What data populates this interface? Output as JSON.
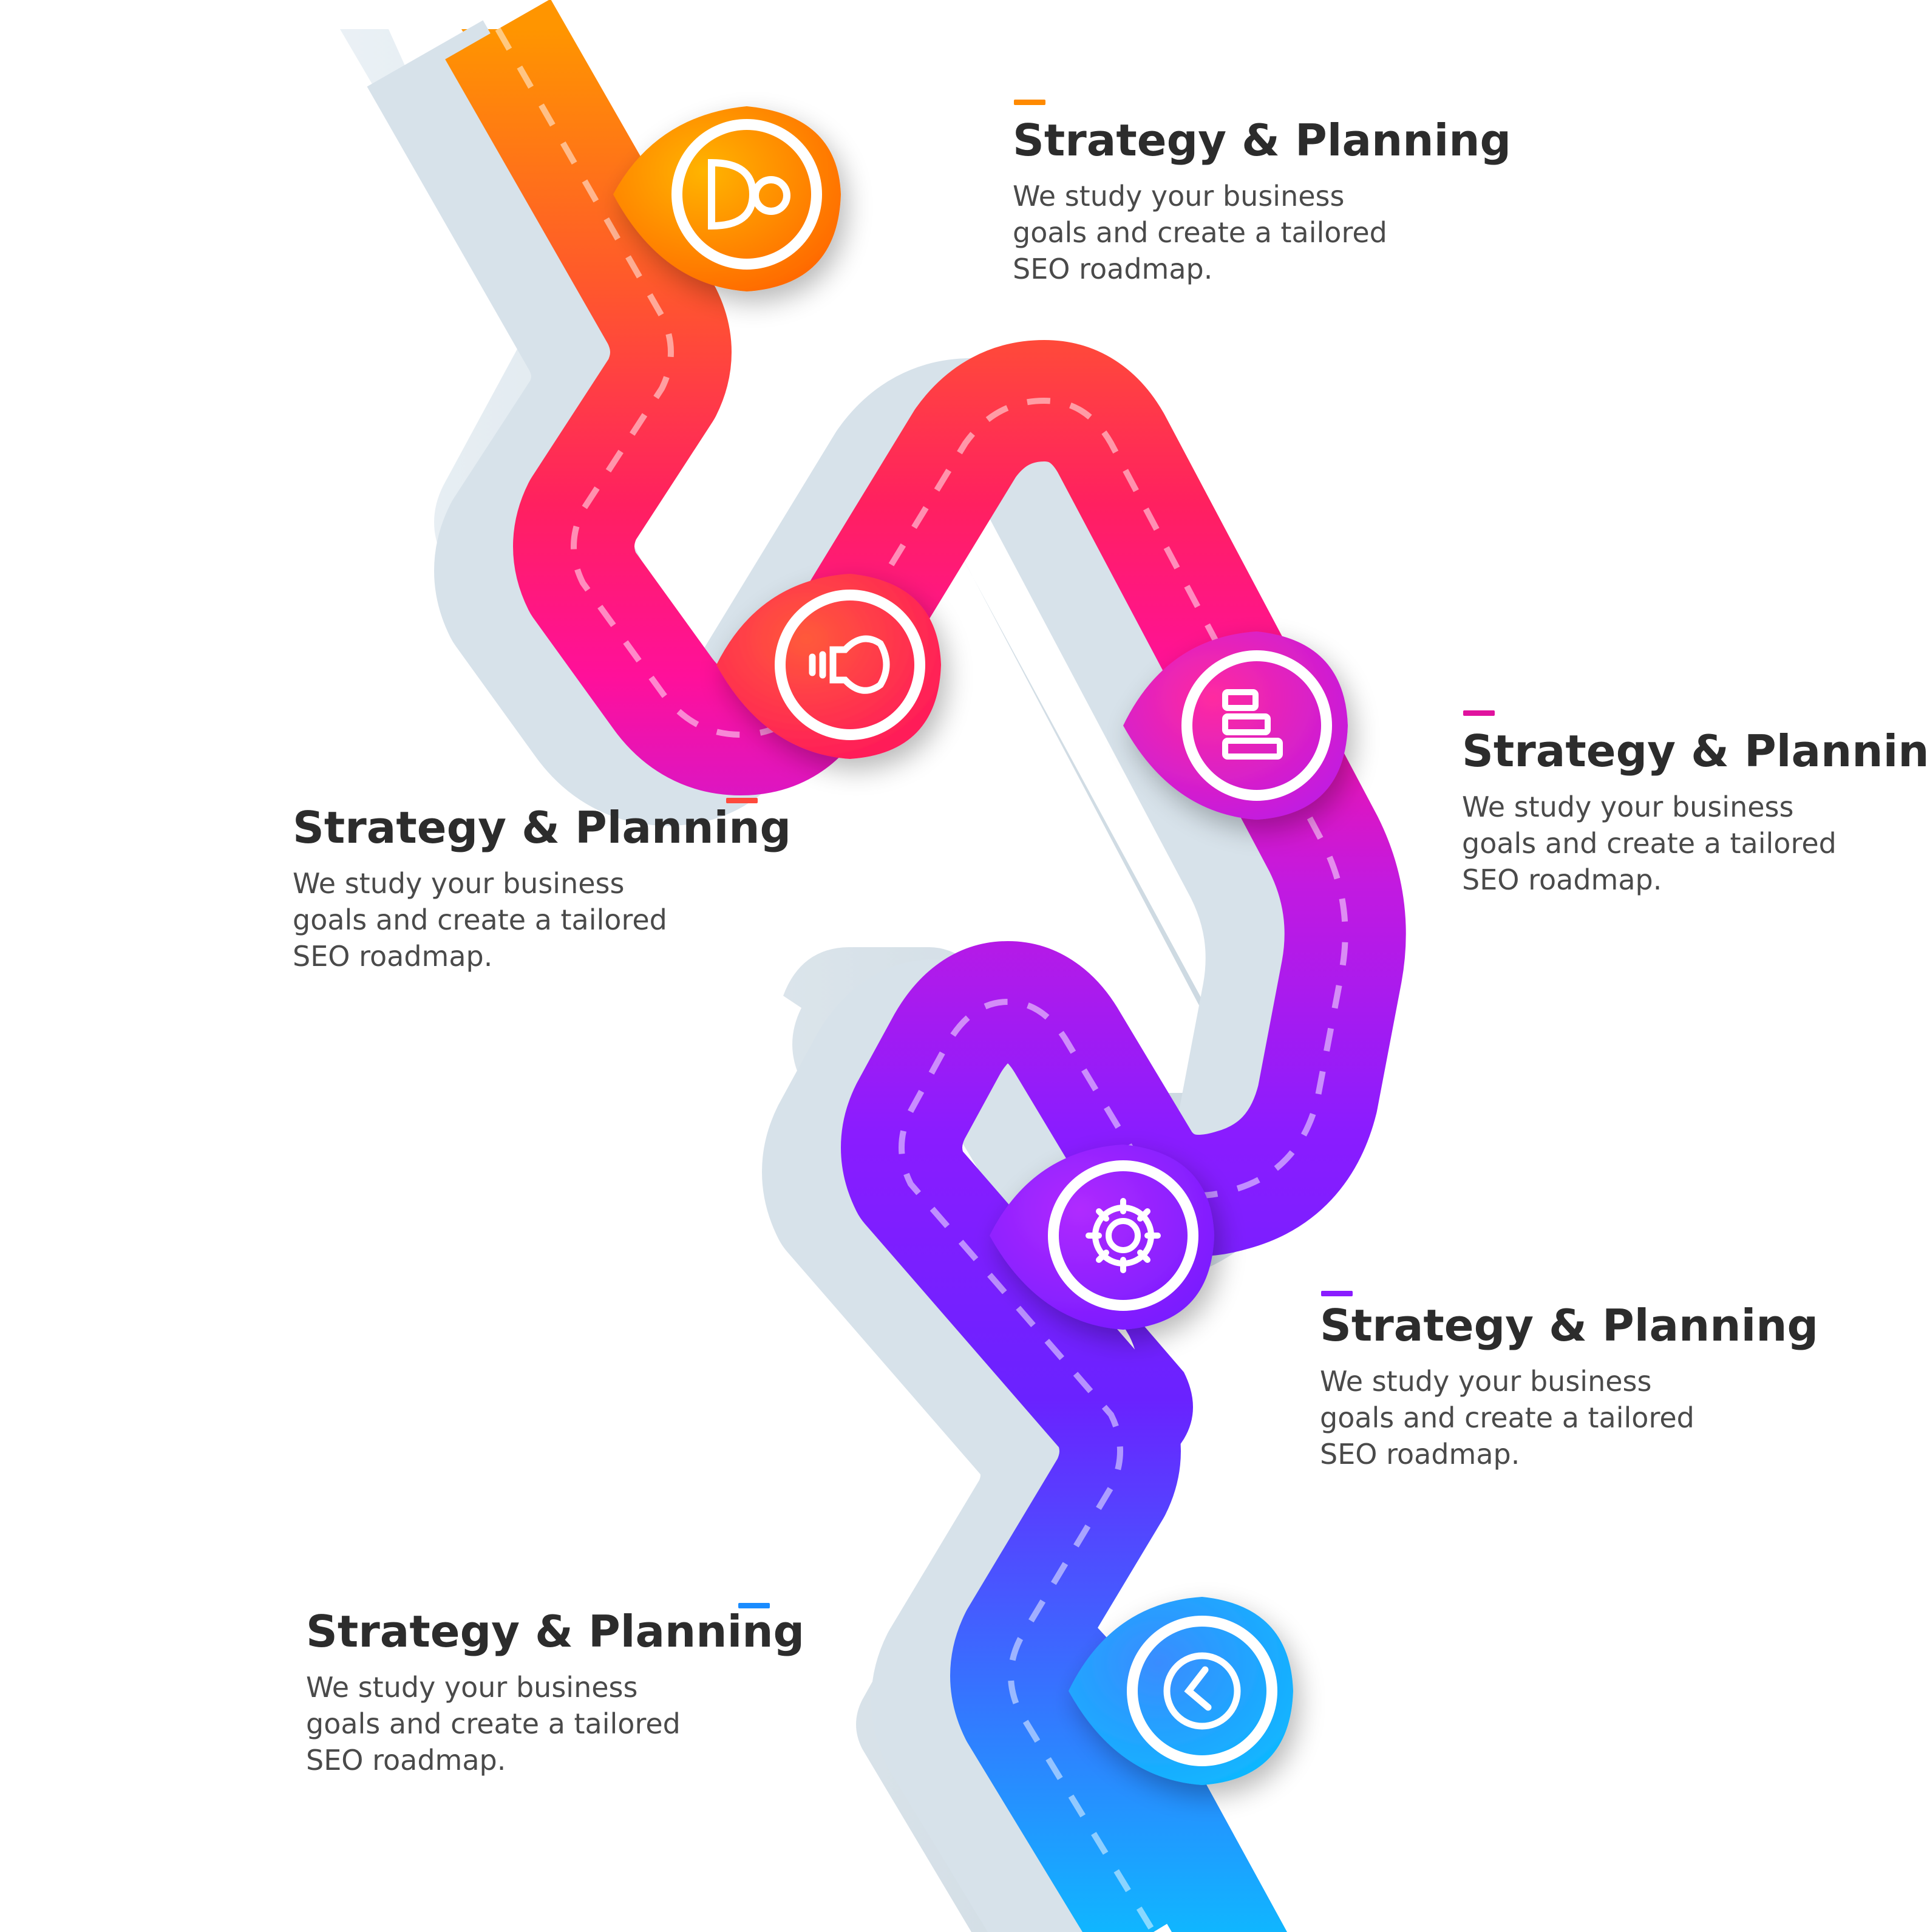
{
  "colors": {
    "orange": "#ff8a00",
    "red_orange": "#ff4a3d",
    "pink": "#ff1a7a",
    "magenta": "#d21ad6",
    "purple": "#8a1cff",
    "violet": "#6a22ff",
    "blue": "#1aa6ff",
    "road_side": "#d6e2ea",
    "dash": "rgba(255,255,255,0.55)"
  },
  "steps": [
    {
      "title": "Strategy & Planning",
      "description": "We study your business goals and create a tailored SEO roadmap.",
      "icon": "toggle-dot-icon",
      "accent_color": "#ff8a00"
    },
    {
      "title": "Strategy & Planning",
      "description": "We study your business goals and create a tailored SEO roadmap.",
      "icon": "lightbulb-icon",
      "accent_color": "#ff4a3d"
    },
    {
      "title": "Strategy & Planning",
      "description": "We study your business goals and create a tailored SEO roadmap.",
      "icon": "bar-chart-icon",
      "accent_color": "#e0139e"
    },
    {
      "title": "Strategy & Planning",
      "description": "We study your business goals and create a tailored SEO roadmap.",
      "icon": "gear-icon",
      "accent_color": "#8a1cff"
    },
    {
      "title": "Strategy & Planning",
      "description": "We study your business goals and create a tailored SEO roadmap.",
      "icon": "clock-icon",
      "accent_color": "#1a8cff"
    }
  ]
}
